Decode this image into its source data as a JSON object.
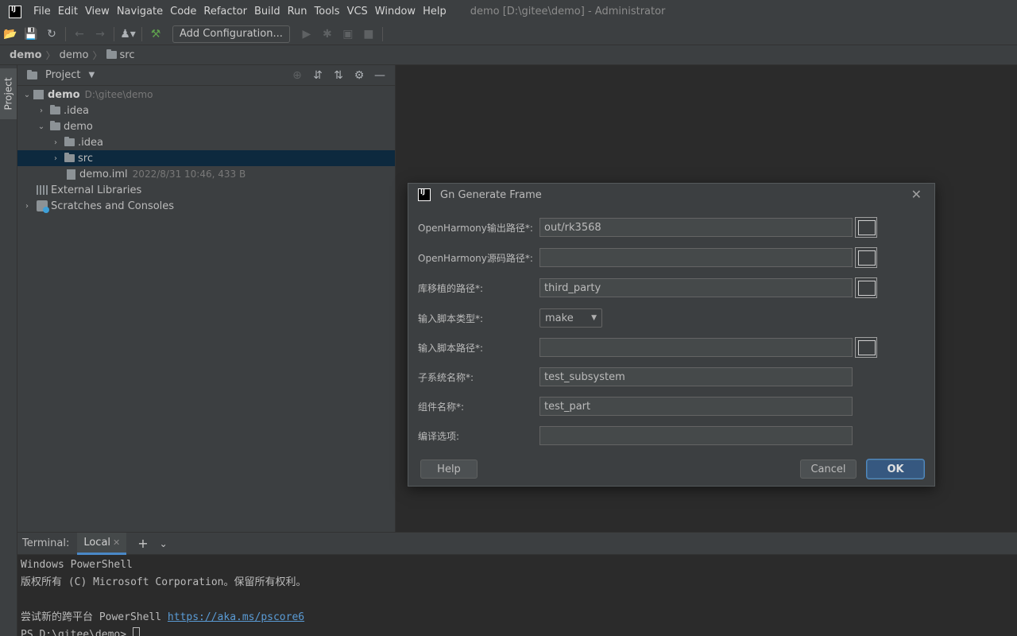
{
  "app": {
    "icon": "intellij-logo-icon",
    "window_title": "demo [D:\\gitee\\demo] - Administrator",
    "menu": [
      "File",
      "Edit",
      "View",
      "Navigate",
      "Code",
      "Refactor",
      "Build",
      "Run",
      "Tools",
      "VCS",
      "Window",
      "Help"
    ]
  },
  "toolbar": {
    "add_configuration": "Add Configuration..."
  },
  "breadcrumb": [
    "demo",
    "demo",
    "src"
  ],
  "sidebar": {
    "project_tab": "Project"
  },
  "project_panel": {
    "title": "Project",
    "tree": [
      {
        "label": "demo",
        "meta": "D:\\gitee\\demo",
        "expanded": true
      },
      {
        "label": ".idea"
      },
      {
        "label": "demo",
        "expanded": true
      },
      {
        "label": ".idea"
      },
      {
        "label": "src",
        "selected": true
      },
      {
        "label": "demo.iml",
        "meta": "2022/8/31 10:46, 433 B"
      },
      {
        "label": "External Libraries"
      },
      {
        "label": "Scratches and Consoles"
      }
    ]
  },
  "dialog": {
    "title": "Gn Generate Frame",
    "fields": [
      {
        "label": "OpenHarmony输出路径*:",
        "value": "out/rk3568"
      },
      {
        "label": "OpenHarmony源码路径*:",
        "value": ""
      },
      {
        "label": "库移植的路径*:",
        "value": "third_party"
      },
      {
        "label": "输入脚本类型*:",
        "value": "make"
      },
      {
        "label": "输入脚本路径*:",
        "value": ""
      },
      {
        "label": "子系统名称*:",
        "value": "test_subsystem"
      },
      {
        "label": "组件名称*:",
        "value": "test_part"
      },
      {
        "label": "编译选项:",
        "value": ""
      }
    ],
    "help_button": "Help",
    "cancel_button": "Cancel",
    "ok_button": "OK"
  },
  "terminal": {
    "title": "Terminal:",
    "tab": "Local",
    "lines": [
      "Windows PowerShell",
      "版权所有 (C) Microsoft Corporation。保留所有权利。",
      "",
      "尝试新的跨平台 PowerShell "
    ],
    "link": "https://aka.ms/pscore6",
    "prompt": "PS D:\\gitee\\demo> "
  },
  "colors": {
    "accent": "#4a88c7",
    "selection": "#0d293e",
    "panel_bg": "#3c3f41",
    "editor_bg": "#2b2b2b"
  }
}
